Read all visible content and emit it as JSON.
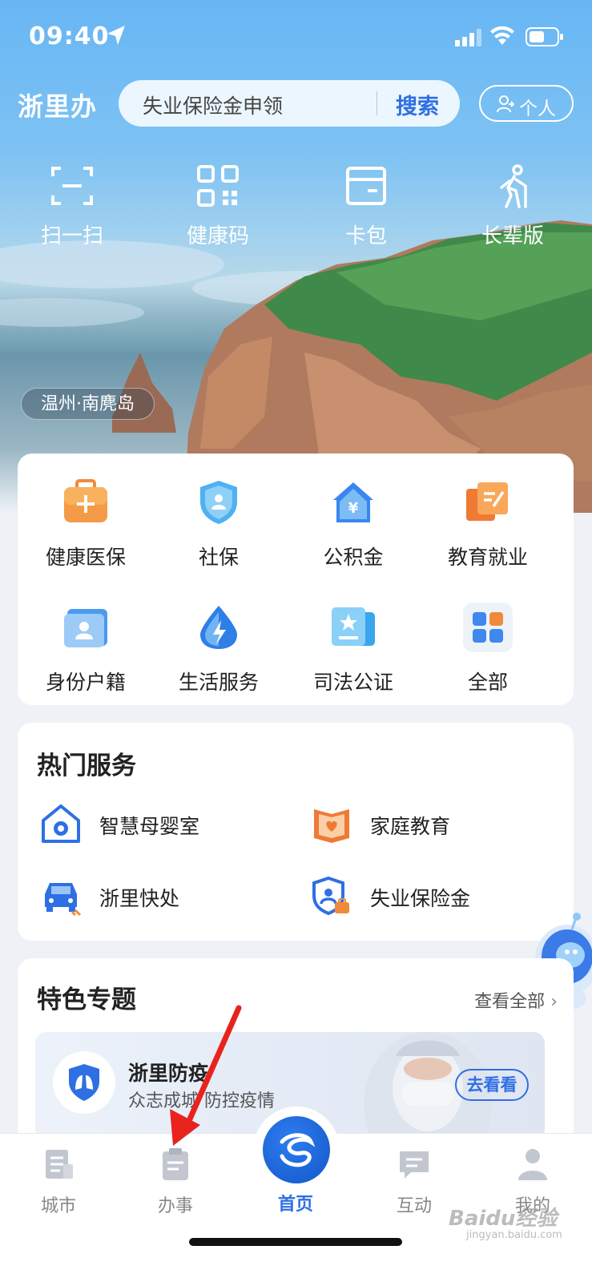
{
  "status_bar": {
    "time": "09:40"
  },
  "header": {
    "brand": "浙里办",
    "search_placeholder": "失业保险金申领",
    "search_button": "搜索",
    "personal_button": "个人"
  },
  "quick_actions": [
    {
      "label": "扫一扫",
      "icon": "scan-icon"
    },
    {
      "label": "健康码",
      "icon": "qr-code-icon"
    },
    {
      "label": "卡包",
      "icon": "card-wallet-icon"
    },
    {
      "label": "长辈版",
      "icon": "elder-mode-icon"
    }
  ],
  "location_tag": "温州·南麂岛",
  "services": [
    {
      "label": "健康医保",
      "icon": "medical-kit-icon",
      "color": "#f08a3a"
    },
    {
      "label": "社保",
      "icon": "social-security-shield-icon",
      "color": "#3fa7ef"
    },
    {
      "label": "公积金",
      "icon": "housing-fund-icon",
      "color": "#3a86f0"
    },
    {
      "label": "教育就业",
      "icon": "education-icon",
      "color": "#f07a34"
    },
    {
      "label": "身份户籍",
      "icon": "id-card-icon",
      "color": "#4a9af0"
    },
    {
      "label": "生活服务",
      "icon": "water-drop-bolt-icon",
      "color": "#2f7fe8"
    },
    {
      "label": "司法公证",
      "icon": "justice-icon",
      "color": "#39a6ee"
    },
    {
      "label": "全部",
      "icon": "all-apps-icon",
      "color": "#3f88ee"
    }
  ],
  "hot_services": {
    "title": "热门服务",
    "items": [
      {
        "label": "智慧母婴室",
        "icon": "baby-room-icon"
      },
      {
        "label": "家庭教育",
        "icon": "family-education-icon"
      },
      {
        "label": "浙里快处",
        "icon": "car-accident-icon"
      },
      {
        "label": "失业保险金",
        "icon": "unemployment-insurance-icon"
      }
    ]
  },
  "featured": {
    "title": "特色专题",
    "see_all": "查看全部",
    "banner_title": "浙里防疫",
    "banner_subtitle": "众志成城 防控疫情",
    "banner_button": "去看看"
  },
  "tabbar": [
    {
      "label": "城市",
      "icon": "city-icon"
    },
    {
      "label": "办事",
      "icon": "affairs-icon"
    },
    {
      "label": "首页",
      "icon": "home-logo-icon"
    },
    {
      "label": "互动",
      "icon": "chat-icon"
    },
    {
      "label": "我的",
      "icon": "profile-icon"
    }
  ],
  "watermark": {
    "main": "Baidu经验",
    "sub": "jingyan.baidu.com"
  },
  "colors": {
    "accent": "#2f6fe4",
    "orange": "#f08a3a"
  }
}
